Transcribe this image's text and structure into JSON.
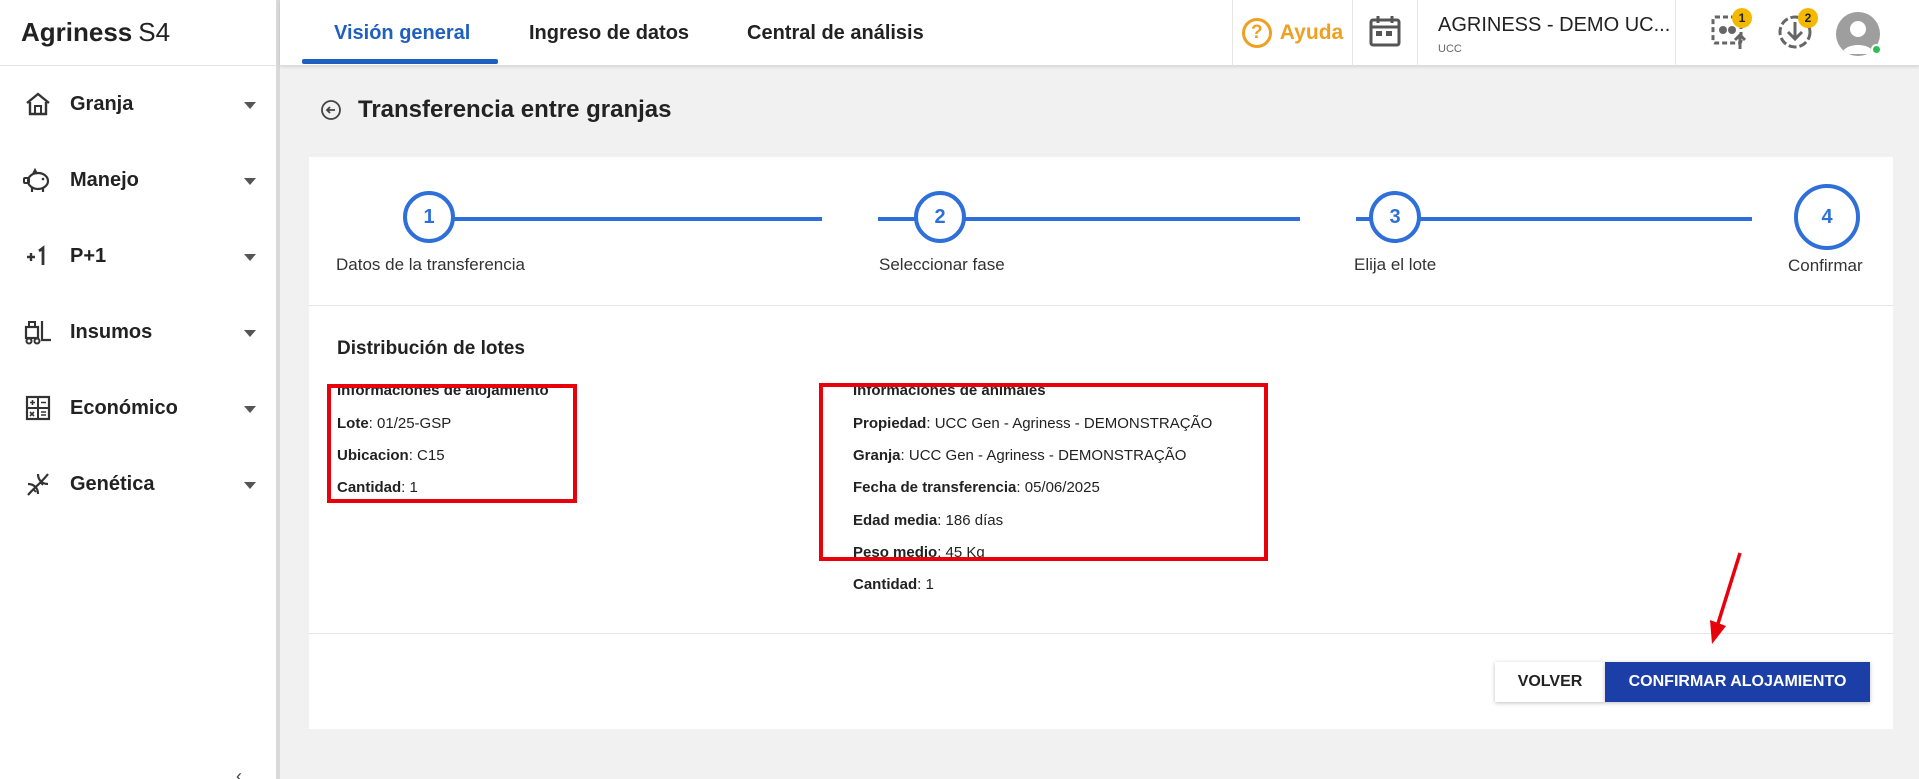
{
  "brand": {
    "name": "Agriness",
    "suffix": "S4"
  },
  "sidebar": {
    "items": [
      {
        "label": "Granja",
        "icon": "home-icon"
      },
      {
        "label": "Manejo",
        "icon": "pig-icon"
      },
      {
        "label": "P+1",
        "icon": "plus-one-icon"
      },
      {
        "label": "Insumos",
        "icon": "forklift-icon"
      },
      {
        "label": "Económico",
        "icon": "calculator-icon"
      },
      {
        "label": "Genética",
        "icon": "dna-icon"
      }
    ],
    "collapse_hint": "‹"
  },
  "topbar": {
    "tabs": [
      {
        "label": "Visión general",
        "active": true
      },
      {
        "label": "Ingreso de datos",
        "active": false
      },
      {
        "label": "Central de análisis",
        "active": false
      }
    ],
    "help_label": "Ayuda",
    "company_name": "AGRINESS - DEMO UC...",
    "company_sub": "UCC",
    "sync_badge": "1",
    "download_badge": "2"
  },
  "page": {
    "title": "Transferencia entre granjas"
  },
  "stepper": {
    "steps": [
      {
        "number": "1",
        "label": "Datos de la transferencia"
      },
      {
        "number": "2",
        "label": "Seleccionar fase"
      },
      {
        "number": "3",
        "label": "Elija el lote"
      },
      {
        "number": "4",
        "label": "Confirmar"
      }
    ],
    "current": 4
  },
  "distribution": {
    "title": "Distribución de lotes",
    "housing": {
      "heading": "Informaciones de alojamiento",
      "rows": [
        {
          "key": "Lote",
          "value": ": 01/25-GSP"
        },
        {
          "key": "Ubicacion",
          "value": ": C15"
        },
        {
          "key": "Cantidad",
          "value": ": 1"
        }
      ]
    },
    "animals": {
      "heading": "Informaciones de animales",
      "rows": [
        {
          "key": "Propiedad",
          "value": ": UCC Gen - Agriness - DEMONSTRAÇÃO"
        },
        {
          "key": "Granja",
          "value": ": UCC Gen - Agriness - DEMONSTRAÇÃO"
        },
        {
          "key": "Fecha de transferencia",
          "value": ": 05/06/2025"
        },
        {
          "key": "Edad media",
          "value": ": 186 días"
        },
        {
          "key": "Peso medio",
          "value": ": 45 Kg"
        },
        {
          "key": "Cantidad",
          "value": ": 1"
        }
      ]
    }
  },
  "actions": {
    "back_label": "VOLVER",
    "confirm_label": "CONFIRMAR ALOJAMIENTO"
  },
  "colors": {
    "primary": "#2e6fd9",
    "confirm_button": "#1b3fa6",
    "highlight": "#e8000b",
    "help": "#f0a020",
    "badge": "#f5b800"
  }
}
